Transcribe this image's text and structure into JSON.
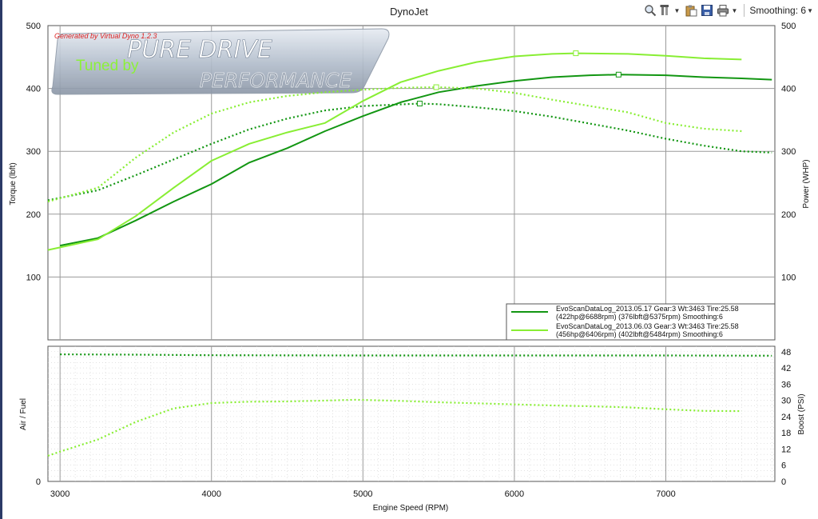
{
  "title": "DynoJet",
  "toolbar": {
    "smoothing_label": "Smoothing: 6",
    "icons": [
      "zoom-icon",
      "tools-icon",
      "clipboard-icon",
      "save-icon",
      "print-icon"
    ]
  },
  "watermark": {
    "generated_by": "Generated by Virtual Dyno 1.2.3",
    "logo_line1": "PURE DRIVE",
    "logo_line2": "PERFORMANCE",
    "tuned_by": "Tuned by"
  },
  "colors": {
    "run1": "#129612",
    "run2": "#88ee33",
    "grid": "#9a9a9a",
    "background": "#ffffff",
    "generated_by": "#dd2222",
    "tuned_by": "#8cf03a"
  },
  "legend": {
    "placement": "bottom-right",
    "entries": [
      {
        "line1": "EvoScanDataLog_2013.05.17 Gear:3 Wt:3463 Tire:25.58",
        "line2": "(422hp@6688rpm) (376lbft@5375rpm) Smoothing:6"
      },
      {
        "line1": "EvoScanDataLog_2013.06.03 Gear:3 Wt:3463 Tire:25.58",
        "line2": "(456hp@6406rpm) (402lbft@5484rpm) Smoothing:6"
      }
    ]
  },
  "chart_data": [
    {
      "type": "line",
      "panel": "top",
      "xlabel": "",
      "ylabel": "Torque (lbft)",
      "y2label": "Power (WHP)",
      "xlim": [
        2920,
        7720
      ],
      "ylim": [
        0,
        500
      ],
      "y2lim": [
        0,
        500
      ],
      "xticks": [
        3000,
        4000,
        5000,
        6000,
        7000
      ],
      "yticks": [
        100,
        200,
        300,
        400,
        500
      ],
      "y2ticks": [
        100,
        200,
        300,
        400,
        500
      ],
      "grid": true,
      "series": [
        {
          "name": "EvoScanDataLog_2013.05.17",
          "metric": "power",
          "style": "solid",
          "color": "#129612",
          "x": [
            3000,
            3250,
            3500,
            3750,
            4000,
            4250,
            4500,
            4750,
            5000,
            5250,
            5500,
            5750,
            6000,
            6250,
            6500,
            6688,
            7000,
            7250,
            7500,
            7700
          ],
          "y": [
            150,
            162,
            190,
            220,
            248,
            282,
            305,
            332,
            356,
            378,
            394,
            404,
            412,
            418,
            421,
            422,
            421,
            418,
            416,
            414
          ],
          "marker": {
            "x": 6688,
            "y": 422
          }
        },
        {
          "name": "EvoScanDataLog_2013.05.17",
          "metric": "torque",
          "style": "dotted",
          "color": "#129612",
          "x": [
            2920,
            3250,
            3500,
            3750,
            4000,
            4250,
            4500,
            4750,
            5000,
            5375,
            5500,
            5750,
            6000,
            6250,
            6500,
            6750,
            7000,
            7250,
            7500,
            7700
          ],
          "y": [
            222,
            238,
            262,
            287,
            312,
            335,
            352,
            365,
            372,
            376,
            375,
            370,
            364,
            355,
            344,
            333,
            320,
            309,
            300,
            298
          ],
          "marker": {
            "x": 5375,
            "y": 376
          }
        },
        {
          "name": "EvoScanDataLog_2013.06.03",
          "metric": "power",
          "style": "solid",
          "color": "#88ee33",
          "x": [
            2920,
            3250,
            3500,
            3750,
            4000,
            4250,
            4500,
            4750,
            5000,
            5250,
            5500,
            5750,
            6000,
            6250,
            6406,
            6750,
            7000,
            7250,
            7500
          ],
          "y": [
            143,
            160,
            197,
            242,
            285,
            312,
            330,
            345,
            380,
            410,
            428,
            442,
            451,
            455,
            456,
            455,
            452,
            448,
            446
          ],
          "marker": {
            "x": 6406,
            "y": 456
          }
        },
        {
          "name": "EvoScanDataLog_2013.06.03",
          "metric": "torque",
          "style": "dotted",
          "color": "#88ee33",
          "x": [
            2920,
            3250,
            3500,
            3750,
            4000,
            4250,
            4500,
            4750,
            5000,
            5250,
            5484,
            5750,
            6000,
            6250,
            6500,
            6750,
            7000,
            7250,
            7500
          ],
          "y": [
            220,
            242,
            290,
            330,
            360,
            378,
            388,
            394,
            398,
            401,
            402,
            400,
            393,
            382,
            372,
            362,
            345,
            336,
            332
          ],
          "marker": {
            "x": 5484,
            "y": 402
          }
        }
      ]
    },
    {
      "type": "line",
      "panel": "bottom",
      "xlabel": "Engine Speed (RPM)",
      "ylabel": "Air / Fuel",
      "y2label": "Boost (PSI)",
      "xlim": [
        2920,
        7720
      ],
      "y2lim": [
        0,
        50
      ],
      "xticks": [
        3000,
        4000,
        5000,
        6000,
        7000
      ],
      "yticks": [
        0
      ],
      "y2ticks": [
        0,
        6,
        12,
        18,
        24,
        30,
        36,
        42,
        48
      ],
      "grid": true,
      "series": [
        {
          "name": "Air / Fuel",
          "style": "dotted",
          "color": "#129612",
          "x": [
            3000,
            3500,
            4000,
            5000,
            6000,
            7000,
            7700
          ],
          "y": [
            47.0,
            46.9,
            46.7,
            46.6,
            46.6,
            46.6,
            46.5
          ]
        },
        {
          "name": "Boost",
          "style": "dotted",
          "color": "#88ee33",
          "x": [
            2920,
            3000,
            3250,
            3500,
            3750,
            4000,
            4250,
            4500,
            4750,
            4950,
            5250,
            5500,
            5750,
            6000,
            6250,
            6500,
            6750,
            7000,
            7250,
            7500
          ],
          "y": [
            9.5,
            11,
            15.5,
            22,
            27,
            29,
            29.5,
            29.6,
            29.9,
            30.2,
            29.8,
            29.3,
            28.9,
            28.5,
            28.1,
            27.8,
            27.4,
            26.7,
            26.1,
            26.0
          ]
        }
      ]
    }
  ]
}
